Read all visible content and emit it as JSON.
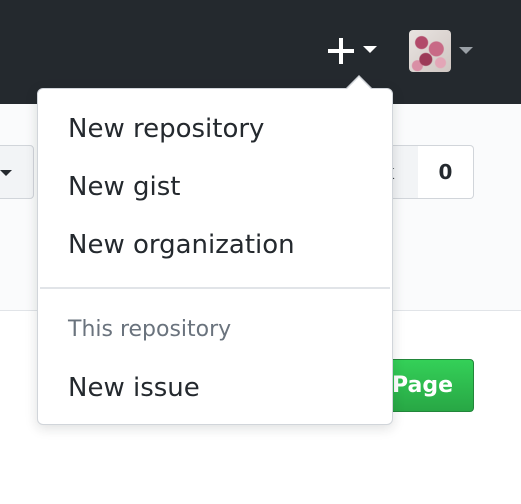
{
  "header": {
    "plus_icon": "plus-icon",
    "caret_icon": "caret-down-icon",
    "avatar_alt": "user avatar"
  },
  "repo_actions": {
    "fork_glyph": "k",
    "fork_count": "0"
  },
  "page_button_label": "Page",
  "dropdown": {
    "items": [
      {
        "label": "New repository"
      },
      {
        "label": "New gist"
      },
      {
        "label": "New organization"
      }
    ],
    "section_header": "This repository",
    "section_items": [
      {
        "label": "New issue"
      }
    ]
  },
  "colors": {
    "topbar": "#24292e",
    "primary_green": "#28a745",
    "text": "#24292e",
    "muted_text": "#6a737d"
  }
}
